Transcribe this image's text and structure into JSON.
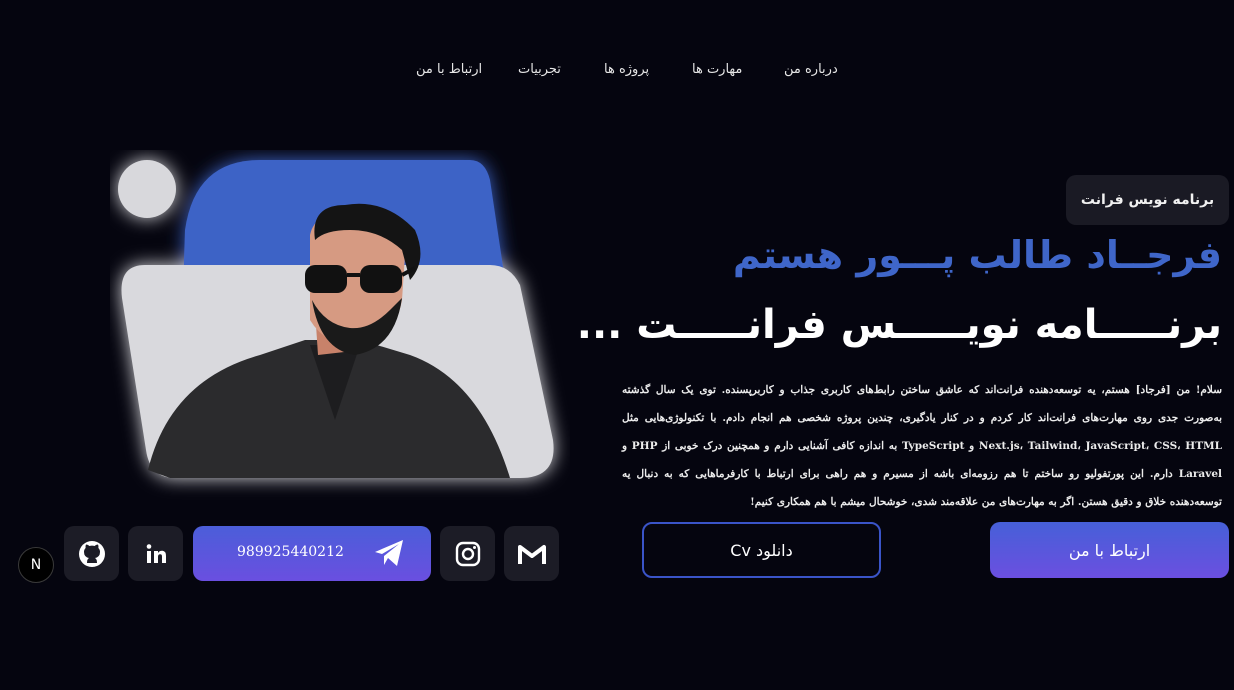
{
  "nav": {
    "items": [
      {
        "label": "درباره من"
      },
      {
        "label": "مهارت ها"
      },
      {
        "label": "پروژه ها"
      },
      {
        "label": "تجربیات"
      },
      {
        "label": "ارتباط با من"
      }
    ]
  },
  "hero": {
    "badge": "برنامه نویس فرانت",
    "name": "فرجــاد طالب پـــور هستم",
    "role": "برنـــــامه نویـــــس فرانـــــت ...",
    "bio": "سلام! من [فرجاد] هستم، یه توسعه‌دهنده فرانت‌اند که عاشق ساختن رابط‌های کاربری جذاب و کاربرپسنده. توی یک سال گذشته به‌صورت جدی روی مهارت‌های فرانت‌اند کار کردم و در کنار یادگیری، چندین پروژه شخصی هم انجام دادم. با تکنولوژی‌هایی مثل Next.js، Tailwind، JavaScript، CSS، HTML و TypeScript به اندازه کافی آشنایی دارم و همچنین درک خوبی از PHP و Laravel دارم. این پورتفولیو رو ساختم تا هم رزومه‌ای باشه از مسیرم و هم راهی برای ارتباط با کارفرماهایی که به دنبال یه توسعه‌دهنده خلاق و دقیق هستن. اگر به مهارت‌های من علاقه‌مند شدی، خوشحال میشم با هم همکاری کنیم!"
  },
  "actions": {
    "contact_label": "ارتباط با من",
    "cv_label": "دانلود Cv"
  },
  "social": {
    "telegram_number": "989925440212",
    "icons": [
      "gmail-icon",
      "instagram-icon",
      "telegram-icon",
      "linkedin-icon",
      "github-icon"
    ]
  },
  "colors": {
    "background": "#05050f",
    "accent_blue": "#3f66c9",
    "button_gradient_start": "#4660d8",
    "button_gradient_end": "#6b4fe0",
    "card": "#1c1c26"
  },
  "devtools": {
    "badge_letter": "N"
  }
}
